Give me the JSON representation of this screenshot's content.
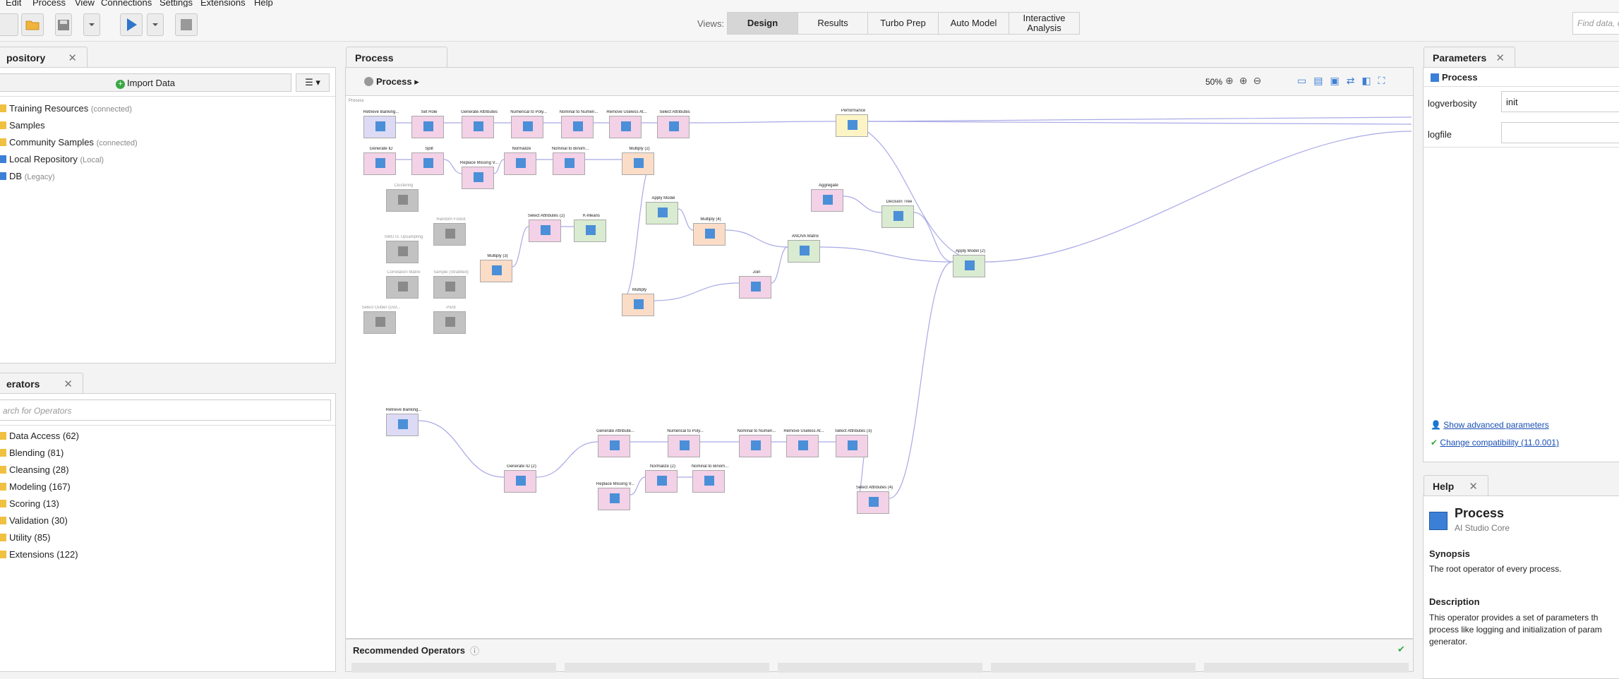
{
  "menu": [
    "Edit",
    "Process",
    "View",
    "Connections",
    "Settings",
    "Extensions",
    "Help"
  ],
  "toolbar": {
    "views_label": "Views:",
    "views": [
      {
        "label": "Design",
        "active": true
      },
      {
        "label": "Results",
        "active": false
      },
      {
        "label": "Turbo Prep",
        "active": false
      },
      {
        "label": "Auto Model",
        "active": false
      },
      {
        "label": "Interactive Analysis",
        "active": false
      }
    ],
    "find_placeholder": "Find data, o"
  },
  "repository": {
    "tab": "pository",
    "import_label": "Import Data",
    "items": [
      {
        "label": "Training Resources",
        "status": "(connected)"
      },
      {
        "label": "Samples",
        "status": ""
      },
      {
        "label": "Community Samples",
        "status": "(connected)"
      },
      {
        "label": "Local Repository",
        "status": "(Local)"
      },
      {
        "label": "DB",
        "status": "(Legacy)"
      }
    ]
  },
  "operators": {
    "tab": "erators",
    "search_placeholder": "arch for Operators",
    "items": [
      "Data Access (62)",
      "Blending (81)",
      "Cleansing (28)",
      "Modeling (167)",
      "Scoring (13)",
      "Validation (30)",
      "Utility (85)",
      "Extensions (122)"
    ]
  },
  "process": {
    "tab": "Process",
    "breadcrumb": "Process",
    "zoom": "50%",
    "canvas_label": "Process",
    "operators": [
      {
        "label": "Retrieve Banking...",
        "color": "lav"
      },
      {
        "label": "Set Role",
        "color": "pink"
      },
      {
        "label": "Generate Attributes",
        "color": "pink"
      },
      {
        "label": "Numerical to Poly...",
        "color": "pink"
      },
      {
        "label": "Nominal to Numeri...",
        "color": "pink"
      },
      {
        "label": "Remove Useless At...",
        "color": "pink"
      },
      {
        "label": "Select Attributes",
        "color": "pink"
      },
      {
        "label": "Performance",
        "color": "yellow"
      },
      {
        "label": "Generate ID",
        "color": "pink"
      },
      {
        "label": "Split",
        "color": "pink"
      },
      {
        "label": "Replace Missing V...",
        "color": "pink"
      },
      {
        "label": "Normalize",
        "color": "pink"
      },
      {
        "label": "Nominal to Binom...",
        "color": "pink"
      },
      {
        "label": "Multiply (2)",
        "color": "peach"
      },
      {
        "label": "Clustering",
        "color": "grey"
      },
      {
        "label": "Aggregate",
        "color": "pink"
      },
      {
        "label": "Decision Tree",
        "color": "green"
      },
      {
        "label": "Apply Model",
        "color": "green"
      },
      {
        "label": "Random Forest",
        "color": "grey"
      },
      {
        "label": "Select Attributes (2)",
        "color": "pink"
      },
      {
        "label": "K-Means",
        "color": "green"
      },
      {
        "label": "Multiply (4)",
        "color": "peach"
      },
      {
        "label": "ANOVA Matrix",
        "color": "green"
      },
      {
        "label": "SMOTE Upsampling",
        "color": "grey"
      },
      {
        "label": "Multiply (3)",
        "color": "peach"
      },
      {
        "label": "Apply Model (2)",
        "color": "green"
      },
      {
        "label": "Correlation Matrix",
        "color": "grey"
      },
      {
        "label": "Sample (Stratified)",
        "color": "grey"
      },
      {
        "label": "Join",
        "color": "pink"
      },
      {
        "label": "Multiply",
        "color": "peach"
      },
      {
        "label": "Select Outlier (Dist...",
        "color": "grey"
      },
      {
        "label": "Pivot",
        "color": "grey"
      },
      {
        "label": "Retrieve Banking...",
        "color": "lav"
      },
      {
        "label": "Generate Attribute...",
        "color": "pink"
      },
      {
        "label": "Numerical to Poly...",
        "color": "pink"
      },
      {
        "label": "Nominal to Numeri...",
        "color": "pink"
      },
      {
        "label": "Remove Useless At...",
        "color": "pink"
      },
      {
        "label": "Select Attributes (3)",
        "color": "pink"
      },
      {
        "label": "Generate ID (2)",
        "color": "pink"
      },
      {
        "label": "Normalize (2)",
        "color": "pink"
      },
      {
        "label": "Nominal to Binom...",
        "color": "pink"
      },
      {
        "label": "Replace Missing V...",
        "color": "pink"
      },
      {
        "label": "Select Attributes (4)",
        "color": "pink"
      }
    ],
    "recommended_label": "Recommended Operators"
  },
  "parameters": {
    "tab": "Parameters",
    "operator": "Process",
    "rows": [
      {
        "name": "logverbosity",
        "value": "init"
      },
      {
        "name": "logfile",
        "value": ""
      }
    ],
    "advanced_link": "Show advanced parameters",
    "compat_link": "Change compatibility (11.0.001)"
  },
  "help": {
    "tab": "Help",
    "title": "Process",
    "subtitle": "AI Studio Core",
    "synopsis_title": "Synopsis",
    "synopsis": "The root operator of every process.",
    "description_title": "Description",
    "description": "This operator provides a set of parameters th process like logging and initialization of param generator."
  },
  "colors": {
    "accent_blue": "#1a4fb5",
    "pink": "#f3d1e6",
    "peach": "#fbdcc7",
    "green": "#d9ebd0",
    "yellow": "#fdf4c6",
    "lavender": "#dcdaf4",
    "grey": "#c2c2c2"
  }
}
